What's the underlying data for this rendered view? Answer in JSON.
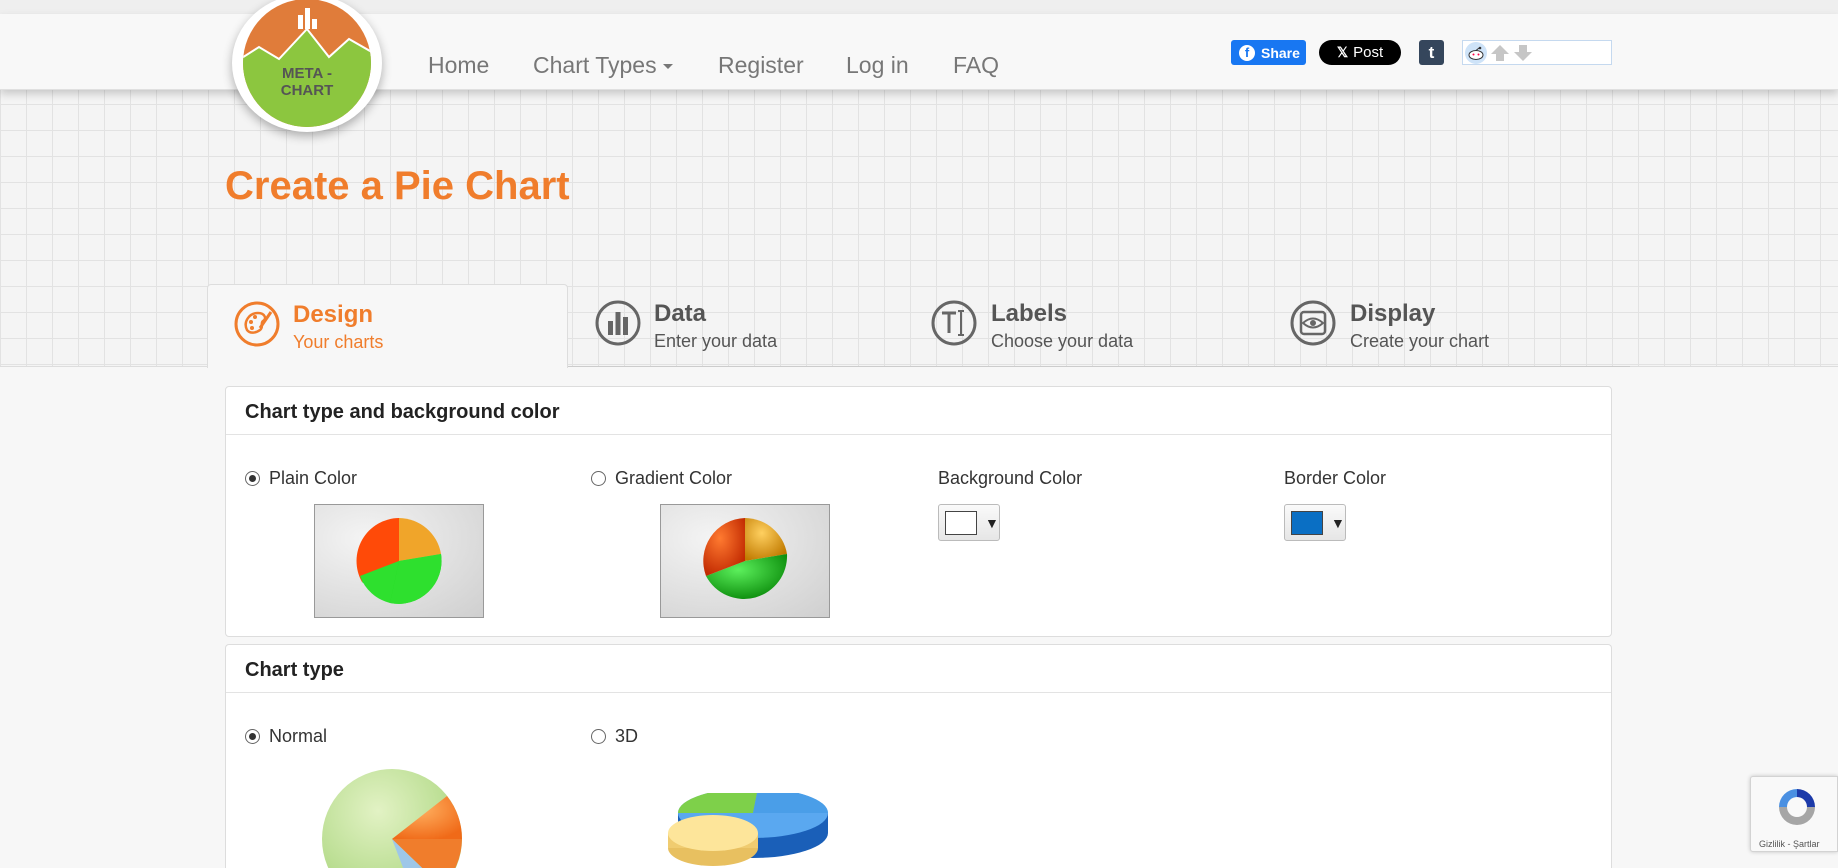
{
  "logo": {
    "line1": "META -",
    "line2": "CHART"
  },
  "nav": {
    "home": "Home",
    "chart_types": "Chart Types",
    "register": "Register",
    "login": "Log in",
    "faq": "FAQ"
  },
  "social": {
    "facebook_share": "Share",
    "x_post": "Post",
    "tumblr": "t"
  },
  "page_title": "Create a Pie Chart",
  "tabs": [
    {
      "title": "Design",
      "subtitle": "Your charts",
      "active": true
    },
    {
      "title": "Data",
      "subtitle": "Enter your data",
      "active": false
    },
    {
      "title": "Labels",
      "subtitle": "Choose your data",
      "active": false
    },
    {
      "title": "Display",
      "subtitle": "Create your chart",
      "active": false
    }
  ],
  "panel_background": {
    "heading": "Chart type and background color",
    "plain_color": "Plain Color",
    "gradient_color": "Gradient Color",
    "background_color_label": "Background Color",
    "border_color_label": "Border Color",
    "background_color_value": "#ffffff",
    "border_color_value": "#0a6fc4",
    "selected": "Plain Color"
  },
  "panel_chart_type": {
    "heading": "Chart type",
    "normal": "Normal",
    "three_d": "3D",
    "selected": "Normal"
  },
  "recaptcha": {
    "links": "Gizlilik - Şartlar"
  },
  "colors": {
    "accent": "#f07d2c",
    "link": "#777777"
  }
}
